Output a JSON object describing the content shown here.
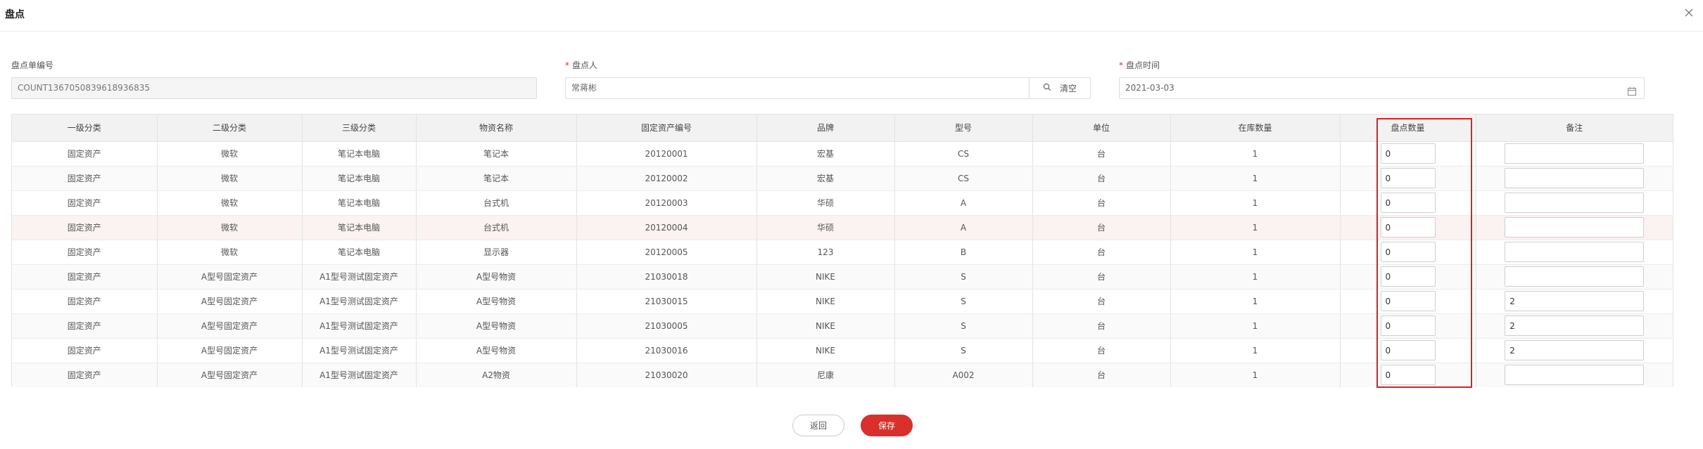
{
  "dialog": {
    "title": "盘点",
    "close_icon": "close-icon"
  },
  "form": {
    "doc_no": {
      "label": "盘点单编号",
      "value": "COUNT1367050839618936835"
    },
    "counter": {
      "label": "盘点人",
      "value": "常蒋彬",
      "search_label": "清空"
    },
    "date": {
      "label": "盘点时间",
      "value": "2021-03-03"
    }
  },
  "table": {
    "headers": [
      "一级分类",
      "二级分类",
      "三级分类",
      "物资名称",
      "固定资产编号",
      "品牌",
      "型号",
      "单位",
      "在库数量",
      "盘点数量",
      "备注"
    ],
    "rows": [
      [
        "固定资产",
        "微软",
        "笔记本电脑",
        "笔记本",
        "20120001",
        "宏基",
        "CS",
        "台",
        "1",
        "0",
        ""
      ],
      [
        "固定资产",
        "微软",
        "笔记本电脑",
        "笔记本",
        "20120002",
        "宏基",
        "CS",
        "台",
        "1",
        "0",
        ""
      ],
      [
        "固定资产",
        "微软",
        "笔记本电脑",
        "台式机",
        "20120003",
        "华硕",
        "A",
        "台",
        "1",
        "0",
        ""
      ],
      [
        "固定资产",
        "微软",
        "笔记本电脑",
        "台式机",
        "20120004",
        "华硕",
        "A",
        "台",
        "1",
        "0",
        ""
      ],
      [
        "固定资产",
        "微软",
        "笔记本电脑",
        "显示器",
        "20120005",
        "123",
        "B",
        "台",
        "1",
        "0",
        ""
      ],
      [
        "固定资产",
        "A型号固定资产",
        "A1型号测试固定资产",
        "A型号物资",
        "21030018",
        "NIKE",
        "S",
        "台",
        "1",
        "0",
        ""
      ],
      [
        "固定资产",
        "A型号固定资产",
        "A1型号测试固定资产",
        "A型号物资",
        "21030015",
        "NIKE",
        "S",
        "台",
        "1",
        "0",
        "2"
      ],
      [
        "固定资产",
        "A型号固定资产",
        "A1型号测试固定资产",
        "A型号物资",
        "21030005",
        "NIKE",
        "S",
        "台",
        "1",
        "0",
        "2"
      ],
      [
        "固定资产",
        "A型号固定资产",
        "A1型号测试固定资产",
        "A型号物资",
        "21030016",
        "NIKE",
        "S",
        "台",
        "1",
        "0",
        "2"
      ],
      [
        "固定资产",
        "A型号固定资产",
        "A1型号测试固定资产",
        "A2物资",
        "21030020",
        "尼康",
        "A002",
        "台",
        "1",
        "0",
        ""
      ]
    ]
  },
  "footer": {
    "back_label": "返回",
    "save_label": "保存"
  },
  "colors": {
    "accent": "#d9302b",
    "highlight": "#e01f1f"
  }
}
